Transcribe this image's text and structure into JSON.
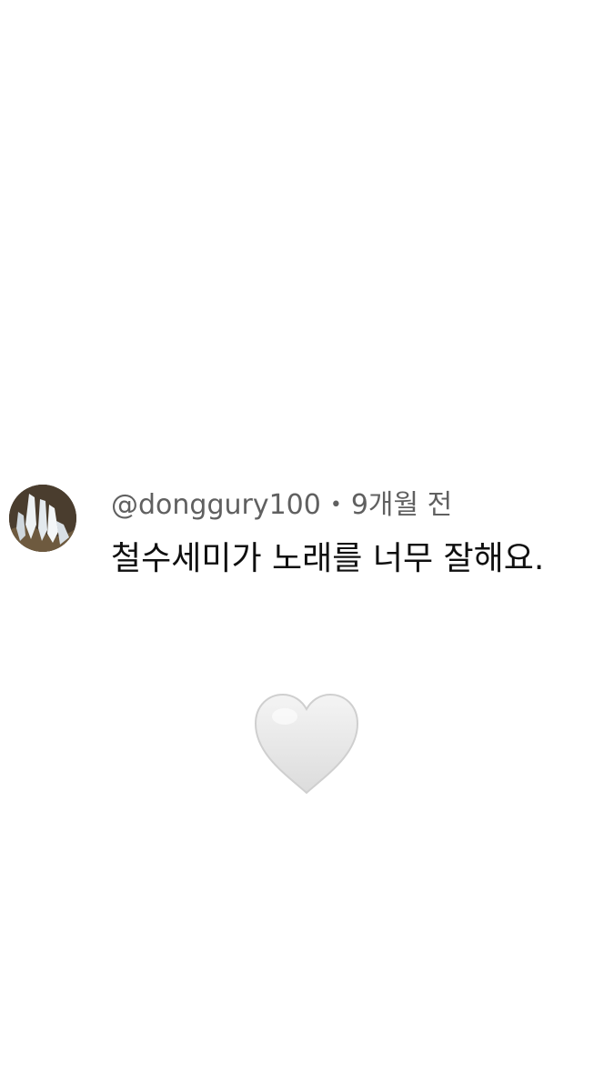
{
  "comment": {
    "username": "@donggury100",
    "separator": "•",
    "time": "9개월 전",
    "text": "철수세미가 노래를 너무 잘해요."
  },
  "icons": {
    "avatar": "avatar-photo",
    "heart": "white-heart-icon"
  },
  "colors": {
    "background": "#ffffff",
    "meta_text": "#606060",
    "body_text": "#0f0f0f",
    "heart": "#e8e8e8"
  }
}
